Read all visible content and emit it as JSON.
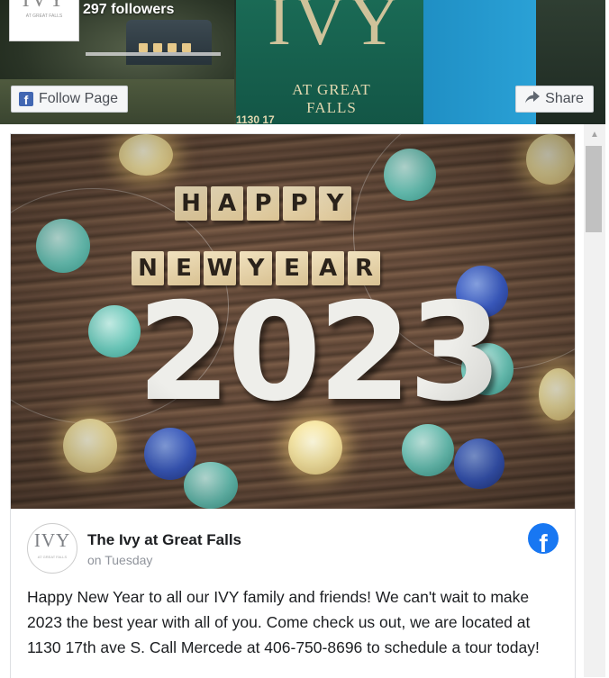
{
  "header": {
    "logo_text": "IVY",
    "logo_subtext": "AT GREAT FALLS",
    "followers": "297 followers",
    "follow_button": "Follow Page",
    "share_button": "Share",
    "cover_sign_title": "IVY",
    "cover_sign_sub": "AT GREAT FALLS",
    "cover_sign_number": "1130 17"
  },
  "post": {
    "image": {
      "tiles_row1": [
        "H",
        "A",
        "P",
        "P",
        "Y"
      ],
      "tiles_row2": [
        "N",
        "E",
        "W",
        "Y",
        "E",
        "A",
        "R"
      ],
      "year": "2023"
    },
    "avatar_text": "IVY",
    "avatar_subtext": "AT GREAT FALLS",
    "page_name": "The Ivy at Great Falls",
    "time": "on Tuesday",
    "text": "Happy New Year to all our IVY family and friends! We can't wait to make 2023 the best year with all of you. Come check us out, we are located at 1130 17th ave S. Call Mercede at 406-750-8696 to schedule a tour today!"
  },
  "icons": {
    "facebook": "facebook-icon",
    "facebook_square": "facebook-square-icon",
    "share": "share-arrow-icon",
    "scroll_up": "scroll-up-arrow-icon"
  },
  "colors": {
    "facebook_blue": "#1877f2",
    "button_bg": "#f5f6f7",
    "text": "#1c1e21",
    "muted": "#90949c"
  }
}
